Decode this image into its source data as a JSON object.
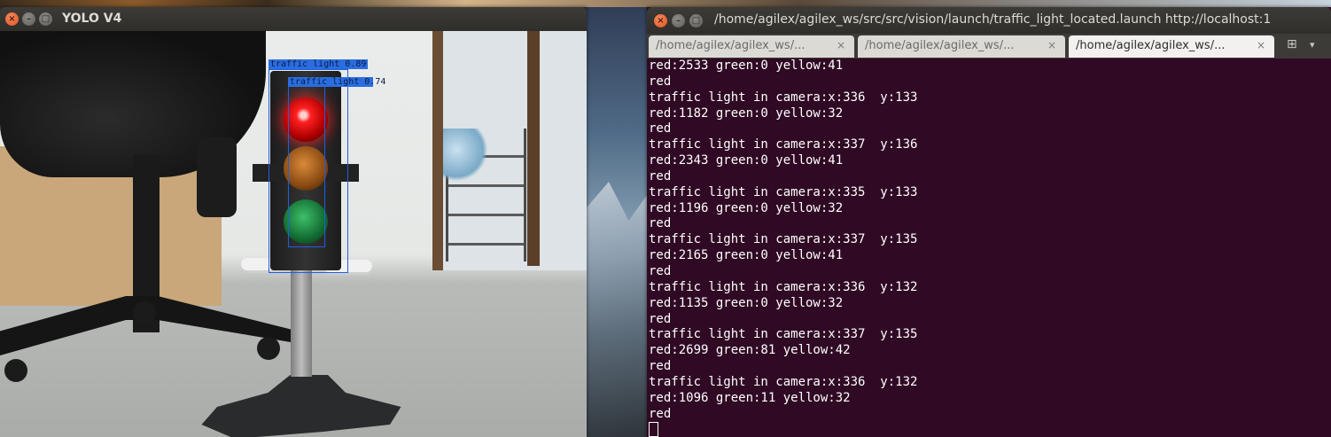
{
  "yolo_window": {
    "title": "YOLO V4",
    "buttons": {
      "close": "×",
      "minimize": "–",
      "maximize": "□"
    },
    "detections": [
      {
        "label": "traffic light  0.89"
      },
      {
        "label": "traffic light  0.74"
      }
    ]
  },
  "terminal_window": {
    "title": "/home/agilex/agilex_ws/src/src/vision/launch/traffic_light_located.launch http://localhost:1",
    "buttons": {
      "close": "×",
      "minimize": "–",
      "maximize": "□"
    },
    "tabs": [
      {
        "label": "/home/agilex/agilex_ws/...",
        "close": "×",
        "active": false
      },
      {
        "label": "/home/agilex/agilex_ws/...",
        "close": "×",
        "active": false
      },
      {
        "label": "/home/agilex/agilex_ws/...",
        "close": "×",
        "active": true
      }
    ],
    "new_tab_icon": "⊞",
    "menu_icon": "▾",
    "lines": [
      "red:2533 green:0 yellow:41",
      "red",
      "traffic light in camera:x:336  y:133",
      "red:1182 green:0 yellow:32",
      "red",
      "traffic light in camera:x:337  y:136",
      "red:2343 green:0 yellow:41",
      "red",
      "traffic light in camera:x:335  y:133",
      "red:1196 green:0 yellow:32",
      "red",
      "traffic light in camera:x:337  y:135",
      "red:2165 green:0 yellow:41",
      "red",
      "traffic light in camera:x:336  y:132",
      "red:1135 green:0 yellow:32",
      "red",
      "traffic light in camera:x:337  y:135",
      "red:2699 green:81 yellow:42",
      "red",
      "traffic light in camera:x:336  y:132",
      "red:1096 green:11 yellow:32",
      "red"
    ]
  },
  "colors": {
    "terminal_bg": "#300a24",
    "terminal_fg": "#ffffff",
    "titlebar": "#3c3b37",
    "detection_box": "#1f5fe0"
  }
}
